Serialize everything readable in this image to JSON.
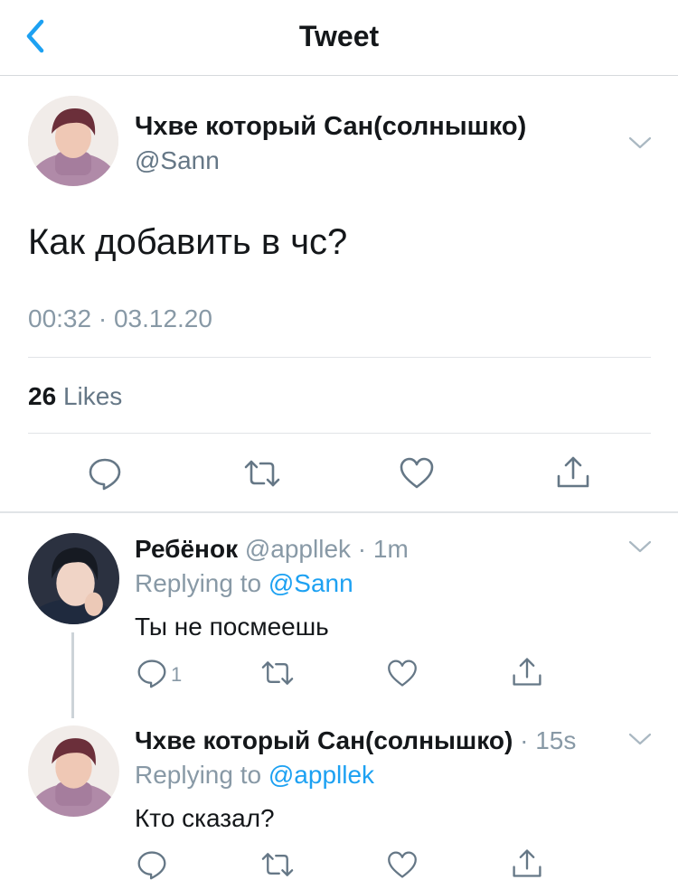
{
  "nav": {
    "title": "Tweet"
  },
  "main_tweet": {
    "author_name": "Чхве который Сан(солнышко)",
    "author_handle": "@Sann",
    "text": "Как добавить в чс?",
    "timestamp": "00:32 · 03.12.20",
    "likes_count": "26",
    "likes_label": "Likes"
  },
  "replies": [
    {
      "author_name": "Ребёнок",
      "meta": "@appllek · 1m",
      "replying_prefix": "Replying to ",
      "replying_mention": "@Sann",
      "text": "Ты не посмеешь",
      "reply_count": "1"
    },
    {
      "author_name": "Чхве который Сан(солнышко)",
      "meta": "· 15s",
      "replying_prefix": "Replying to ",
      "replying_mention": "@appllek",
      "text": "Кто сказал?"
    }
  ],
  "icons": {
    "back": "chevron-left-icon",
    "menu": "chevron-down-icon",
    "reply": "speech-bubble-icon",
    "retweet": "retweet-icon",
    "like": "heart-icon",
    "share": "share-icon"
  },
  "colors": {
    "accent": "#1da1f2",
    "muted": "#8899a6",
    "text": "#14171a"
  }
}
